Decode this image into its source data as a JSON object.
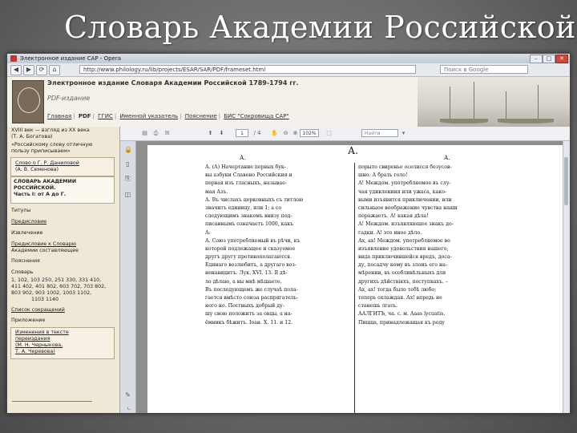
{
  "slide_title": "Словарь Академии Российской",
  "browser": {
    "window_title": "Электронное издание САР - Opera",
    "url": "http://www.philology.ru/lib/projects/ESAR/SAR/PDF/frameset.html",
    "search_placeholder": "Поиск в Google",
    "buttons": {
      "min": "–",
      "max": "□",
      "close": "✕",
      "back": "◀",
      "forward": "▶",
      "reload": "⟳",
      "home": "⌂"
    }
  },
  "site": {
    "title": "Электронное издание Словаря Академии Российской 1789-1794 гг.",
    "subtitle": "PDF-издание",
    "nav": [
      "Главная",
      "PDF",
      "ГГИС",
      "Именной указатель",
      "Пояснение",
      "БИС \"Сокровища САР\""
    ]
  },
  "sidebar": {
    "items_top": [
      "XVIII век — взгляд из XX века",
      "(Т. А. Богатова)",
      "«Российскому слову отличную",
      "пользу приписываем»"
    ],
    "box1": [
      "Слово о Г. Р. Даниловой",
      "(А. В. Семенова)"
    ],
    "box2_title": [
      "СЛОВАРЬ АКАДЕМИИ",
      "РОССИЙСКОЙ.",
      "Часть I: от А до Г."
    ],
    "items_mid": [
      "Титулы",
      "Предисловие",
      "Извлечение",
      "Предисловие к Словарю",
      "Академии составляющее",
      "Пояснения"
    ],
    "slovar": "Словарь",
    "page_numbers": [
      "1, 102, 103 250, 251 330, 331 410,",
      "411 402, 401 802, 603 702, 703 802,",
      "803 902, 903 1002, 1003 1102,",
      "1103 1140"
    ],
    "items_bottom": [
      "Список сокращений",
      "Приложение"
    ],
    "box3": [
      "Изменения в тексте",
      "переиздания",
      "(М. Н. Черныкова,",
      "Т. А. Черевова)"
    ]
  },
  "pdf_toolbar": {
    "page_current": "1",
    "page_total": "/ 4",
    "zoom": "102%",
    "find": "Найти"
  },
  "pdf_page": {
    "header": "А.",
    "left_col_head": "А.",
    "right_col_head": "А.",
    "left_col": [
      "А. (А) Начертание первых бук-",
      "вы азбуки Славено Российския и",
      "первая изъ гласныхъ, называе-",
      "мая Азъ.",
      "А. Въ числахъ церковныхъ съ титлою",
      "значитъ единицу, или 1; а со",
      "следующимъ знакомъ внизу под-",
      "писаннымъ означаетъ 1000, какъ",
      "А:",
      "А. Союз употребляемый въ рѣчи, къ",
      "которой подлежащее и сказуемое",
      "другъ другу противополагаются.",
      "Единаго возлюбитъ, а другаго воз-",
      "ненавидитъ. Лук. XVI. 13. Я дѣ-",
      "ло дѣлаю, а вы мнѣ мѣшаете.",
      "Въ последующемъ же случаѣ пола-",
      "гается вмѣсто союза распрягатель-",
      "ного но. Постныхъ добрый ду-",
      "шу свою положитъ за овцы, а на-",
      "ёмникъ бѣжитъ. Іоан. X. 11. и 12."
    ],
    "right_col": [
      "порыто свиренье оселисся безусов-",
      "шно. А брать голо!",
      "А! Междом. употребляемое въ слу-",
      "чая удивлениия или ужаса, како-",
      "выми изъявится приключении, или",
      "сильныое воображение чувства наши",
      "поражаетъ. А! какая дѣла!",
      "А! Междом. изъявляющее знакъ до-",
      "гадки. А! это иное дѣло.",
      "Ах, ах! Междом. употребляемое во",
      "изъявление удовольствия нашего,",
      "вида приключившейся вредъ, доса-",
      "ду, посадчу кому въ злоиъ его на-",
      "мѣрении, въ особливѣльныхъ для",
      "другихъ дѣйствіяхъ, поступкахъ. –",
      "Ах, ах! тогда было тебѣ любо;",
      "теперь охлаждая. Ах! впредь не",
      "станешь лгать.",
      "ААЛГИТЪ, ча. с. м. Ааas lycuatis.",
      "Пищца, принадлежащая къ роду"
    ]
  }
}
